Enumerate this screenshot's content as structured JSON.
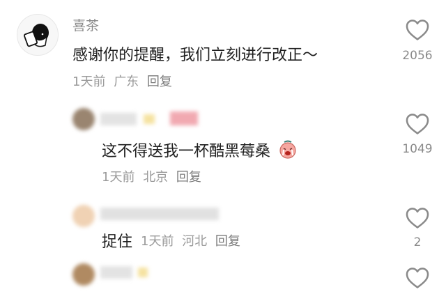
{
  "comments": [
    {
      "name": "喜茶",
      "text": "感谢你的提醒，我们立刻进行改正～",
      "time": "1天前",
      "location": "广东",
      "reply": "回复",
      "likes": "2056",
      "icons": {
        "avatar": "cartoon-boy-avatar-icon",
        "like": "heart-outline-icon"
      }
    },
    {
      "text": "这不得送我一杯酷黑莓桑",
      "time": "1天前",
      "location": "北京",
      "reply": "回复",
      "likes": "1049",
      "icons": {
        "emoji": "crying-face-emoji-icon",
        "like": "heart-outline-icon"
      }
    },
    {
      "text": "捉住",
      "time": "1天前",
      "location": "河北",
      "reply": "回复",
      "likes": "2",
      "icons": {
        "like": "heart-outline-icon"
      }
    },
    {
      "icons": {
        "like": "heart-outline-icon"
      }
    }
  ]
}
